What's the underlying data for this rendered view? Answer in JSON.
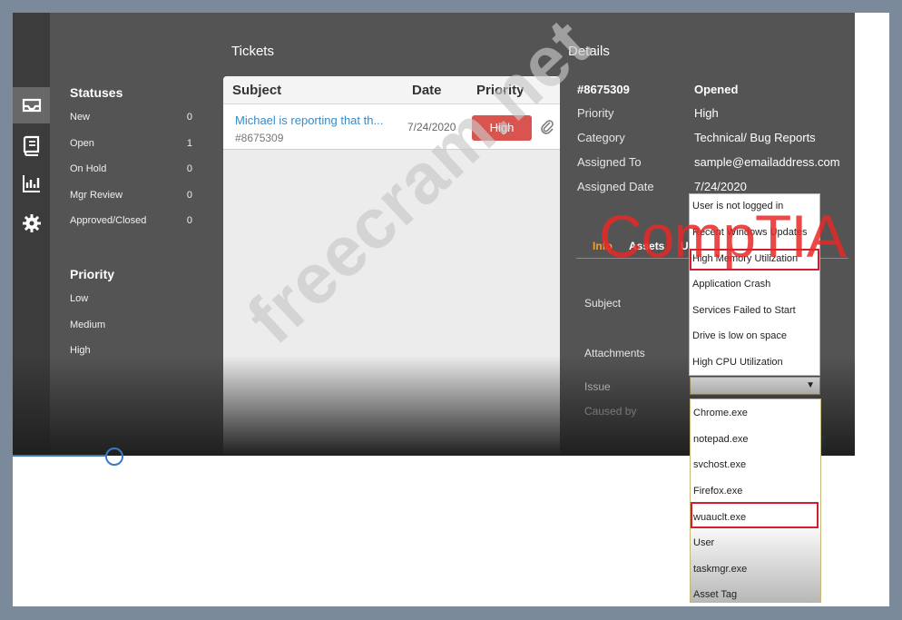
{
  "columns": {
    "tickets": "Tickets",
    "details": "Details"
  },
  "statuses": {
    "title": "Statuses",
    "items": [
      {
        "label": "New",
        "count": "0"
      },
      {
        "label": "Open",
        "count": "1"
      },
      {
        "label": "On Hold",
        "count": "0"
      },
      {
        "label": "Mgr Review",
        "count": "0"
      },
      {
        "label": "Approved/Closed",
        "count": "0"
      }
    ]
  },
  "priority": {
    "title": "Priority",
    "items": [
      "Low",
      "Medium",
      "High"
    ]
  },
  "tickets": {
    "headers": {
      "subject": "Subject",
      "date": "Date",
      "priority": "Priority"
    },
    "rows": [
      {
        "subject": "Michael is reporting that th...",
        "id": "#8675309",
        "date": "7/24/2020",
        "priority": "High"
      }
    ]
  },
  "details": {
    "id": "#8675309",
    "status": "Opened",
    "fields": [
      {
        "label": "Priority",
        "value": "High"
      },
      {
        "label": "Category",
        "value": "Technical/ Bug Reports"
      },
      {
        "label": "Assigned To",
        "value": "sample@emailaddress.com"
      },
      {
        "label": "Assigned Date",
        "value": "7/24/2020"
      }
    ],
    "tabs": [
      "Info",
      "Assets",
      "U"
    ],
    "form_labels": {
      "subject": "Subject",
      "attachments": "Attachments",
      "issue": "Issue",
      "caused_by": "Caused by"
    },
    "issue_value": ""
  },
  "issue_options": [
    "User is not logged in",
    "Recent Windows Updates",
    "High Memory Utilization",
    "Application Crash",
    "Services Failed to Start",
    "Drive is low on space",
    "High CPU Utilization"
  ],
  "issue_selected": "High Memory Utilization",
  "caused_by_options": [
    "Chrome.exe",
    "notepad.exe",
    "svchost.exe",
    "Firefox.exe",
    "wuauclt.exe",
    "User",
    "taskmgr.exe",
    "Asset Tag"
  ],
  "caused_by_selected": "wuauclt.exe",
  "watermarks": {
    "site": "freecram.net",
    "brand": "CompTIA"
  },
  "colors": {
    "priority_high": "#d9534f",
    "link": "#3b8ac4",
    "active_tab": "#f0a030",
    "highlight_box": "#d21f2b"
  }
}
